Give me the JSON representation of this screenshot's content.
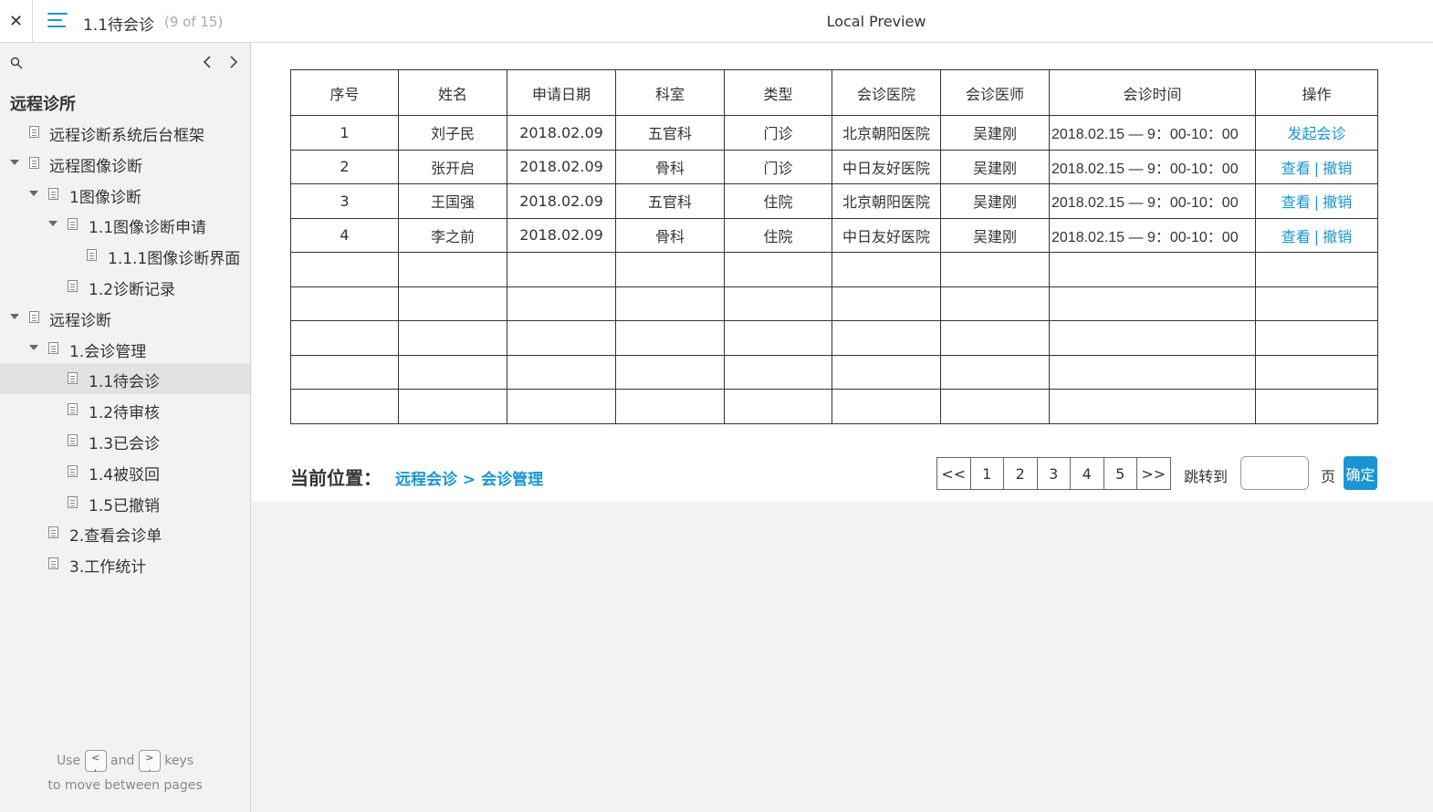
{
  "topbar": {
    "close_glyph": "✕",
    "menu_icon": "hamburger-menu-icon",
    "page_title": "1.1待会诊",
    "page_count": "(9 of 15)",
    "preview_title": "Local Preview"
  },
  "sidebar": {
    "search_icon": "search-icon",
    "prev_glyph": "‹",
    "next_glyph": "›",
    "site_title": "远程诊所",
    "items": [
      {
        "label": "远程诊断系统后台框架",
        "level": 0,
        "expandable": false
      },
      {
        "label": "远程图像诊断",
        "level": 0,
        "expandable": true
      },
      {
        "label": "1图像诊断",
        "level": 1,
        "expandable": true
      },
      {
        "label": "1.1图像诊断申请",
        "level": 2,
        "expandable": true
      },
      {
        "label": "1.1.1图像诊断界面",
        "level": 3,
        "expandable": false
      },
      {
        "label": "1.2诊断记录",
        "level": 2,
        "expandable": false
      },
      {
        "label": "远程诊断",
        "level": 0,
        "expandable": true
      },
      {
        "label": "1.会诊管理",
        "level": 1,
        "expandable": true
      },
      {
        "label": "1.1待会诊",
        "level": 2,
        "expandable": false,
        "selected": true
      },
      {
        "label": "1.2待审核",
        "level": 2,
        "expandable": false
      },
      {
        "label": "1.3已会诊",
        "level": 2,
        "expandable": false
      },
      {
        "label": "1.4被驳回",
        "level": 2,
        "expandable": false
      },
      {
        "label": "1.5已撤销",
        "level": 2,
        "expandable": false
      },
      {
        "label": "2.查看会诊单",
        "level": 1,
        "expandable": false
      },
      {
        "label": "3.工作统计",
        "level": 1,
        "expandable": false
      }
    ],
    "hint": {
      "use": "Use",
      "and": "and",
      "keys": "keys",
      "line2": "to move between pages",
      "key1_top": "<",
      "key1_bottom": ",",
      "key2_top": ">",
      "key2_bottom": "."
    }
  },
  "table": {
    "headers": [
      "序号",
      "姓名",
      "申请日期",
      "科室",
      "类型",
      "会诊医院",
      "会诊医师",
      "会诊时间",
      "操作"
    ],
    "rows": [
      {
        "no": "1",
        "name": "刘子民",
        "date": "2018.02.09",
        "dept": "五官科",
        "type": "门诊",
        "hospital": "北京朝阳医院",
        "doctor": "吴建刚",
        "time": "2018.02.15 — 9：00-10：00",
        "actions": [
          "发起会诊"
        ]
      },
      {
        "no": "2",
        "name": "张开启",
        "date": "2018.02.09",
        "dept": "骨科",
        "type": "门诊",
        "hospital": "中日友好医院",
        "doctor": "吴建刚",
        "time": "2018.02.15 — 9：00-10：00",
        "actions": [
          "查看",
          "撤销"
        ]
      },
      {
        "no": "3",
        "name": "王国强",
        "date": "2018.02.09",
        "dept": "五官科",
        "type": "住院",
        "hospital": "北京朝阳医院",
        "doctor": "吴建刚",
        "time": "2018.02.15 — 9：00-10：00",
        "actions": [
          "查看",
          "撤销"
        ]
      },
      {
        "no": "4",
        "name": "李之前",
        "date": "2018.02.09",
        "dept": "骨科",
        "type": "住院",
        "hospital": "中日友好医院",
        "doctor": "吴建刚",
        "time": "2018.02.15 — 9：00-10：00",
        "actions": [
          "查看",
          "撤销"
        ]
      }
    ],
    "empty_rows": 5,
    "action_separator": "|"
  },
  "location": {
    "label": "当前位置：",
    "path": "远程会诊 > 会诊管理"
  },
  "pagination": {
    "first": "<<",
    "pages": [
      "1",
      "2",
      "3",
      "4",
      "5"
    ],
    "last": ">>",
    "jump_label": "跳转到",
    "jump_value": "",
    "page_unit": "页",
    "confirm": "确定"
  },
  "colors": {
    "accent": "#1a95d4",
    "selected_bg": "#e2e2e2",
    "sidebar_bg": "#f2f2f2"
  }
}
